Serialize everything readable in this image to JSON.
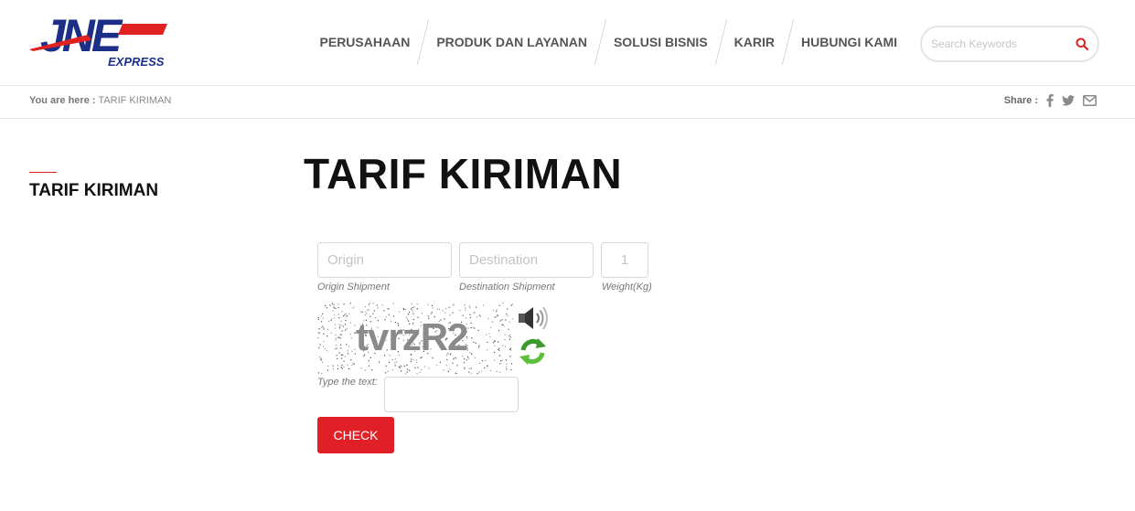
{
  "brand": {
    "logo_text": "JNE",
    "logo_subtext": "EXPRESS",
    "colors": {
      "blue": "#1b2f88",
      "red": "#e0211f"
    }
  },
  "nav": {
    "items": [
      {
        "label": "PERUSAHAAN"
      },
      {
        "label": "PRODUK DAN LAYANAN"
      },
      {
        "label": "SOLUSI BISNIS"
      },
      {
        "label": "KARIR"
      },
      {
        "label": "HUBUNGI KAMI"
      }
    ],
    "search_placeholder": "Search Keywords",
    "search_icon": "search-icon"
  },
  "breadcrumb": {
    "prefix": "You are here :",
    "current": "TARIF KIRIMAN"
  },
  "share": {
    "label": "Share :",
    "icons": [
      "facebook-icon",
      "twitter-icon",
      "email-icon"
    ]
  },
  "sidebar": {
    "title": "TARIF KIRIMAN"
  },
  "main": {
    "title": "TARIF KIRIMAN",
    "form": {
      "origin": {
        "placeholder": "Origin",
        "hint": "Origin Shipment",
        "value": ""
      },
      "destination": {
        "placeholder": "Destination",
        "hint": "Destination Shipment",
        "value": ""
      },
      "weight": {
        "placeholder": "1",
        "hint": "Weight(Kg)",
        "value": ""
      },
      "captcha": {
        "text": "tvrzR2",
        "type_label": "Type the text:",
        "value": ""
      },
      "submit_label": "CHECK"
    }
  },
  "accent_color": "#e11f26"
}
